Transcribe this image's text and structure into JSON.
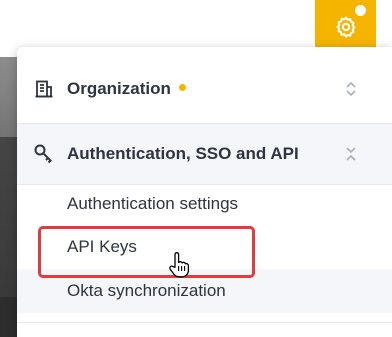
{
  "colors": {
    "accent": "#f5b400",
    "highlight": "#e03c3c",
    "text": "#2e3441"
  },
  "header": {
    "settings_icon": "gear-icon"
  },
  "menu": {
    "sections": [
      {
        "label": "Organization",
        "icon": "building-icon",
        "has_notification": true,
        "chevron": "chevron-up-down-icon"
      },
      {
        "label": "Authentication, SSO and API",
        "icon": "key-icon",
        "chevron": "chevron-collapse-icon"
      }
    ],
    "sub_items": [
      {
        "label": "Authentication settings"
      },
      {
        "label": "API Keys"
      },
      {
        "label": "Okta synchronization",
        "hovered": true
      }
    ]
  }
}
